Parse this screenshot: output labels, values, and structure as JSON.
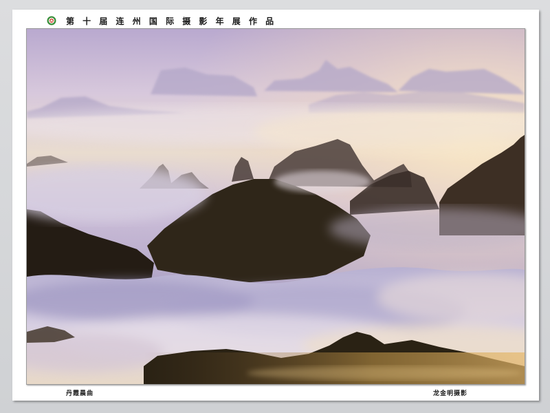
{
  "header": {
    "logo": "exhibition-logo-icon",
    "title": "第 十 届 连 州 国 际 摄 影 年 展 作 品"
  },
  "photo": {
    "subject": "mountain-peaks-sea-of-clouds"
  },
  "captions": {
    "work_title": "丹霞晨曲",
    "photographer": "龙金明摄影"
  },
  "colors": {
    "sky_top": "#c7b8d8",
    "sky_glow": "#f3e3c6",
    "mountain_dark": "#2f2418",
    "cloud": "#d9d2e6"
  }
}
